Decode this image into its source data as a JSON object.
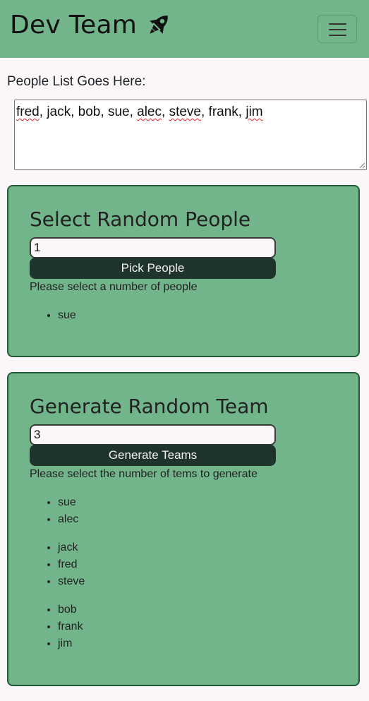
{
  "navbar": {
    "brand": "Dev Team",
    "brand_icon": "rocket-icon",
    "menu_icon": "hamburger-menu-icon",
    "bg_color": "#72b58b"
  },
  "people": {
    "label": "People List Goes Here:",
    "names": [
      "fred",
      "jack",
      "bob",
      "sue",
      "alec",
      "steve",
      "frank",
      "jim"
    ],
    "separator": ", "
  },
  "pick": {
    "title": "Select Random People",
    "input_value": "1",
    "button_label": "Pick People",
    "help": "Please select a number of people",
    "results": [
      "sue"
    ]
  },
  "teams": {
    "title": "Generate Random Team",
    "input_value": "3",
    "button_label": "Generate Teams",
    "help": "Please select the number of tems to generate",
    "groups": [
      [
        "sue",
        "alec"
      ],
      [
        "jack",
        "fred",
        "steve"
      ],
      [
        "bob",
        "frank",
        "jim"
      ]
    ]
  },
  "colors": {
    "card_bg": "#72b58b",
    "card_border": "#1f5a36",
    "button_bg": "#1f352b",
    "page_bg": "#fbf6f7"
  }
}
